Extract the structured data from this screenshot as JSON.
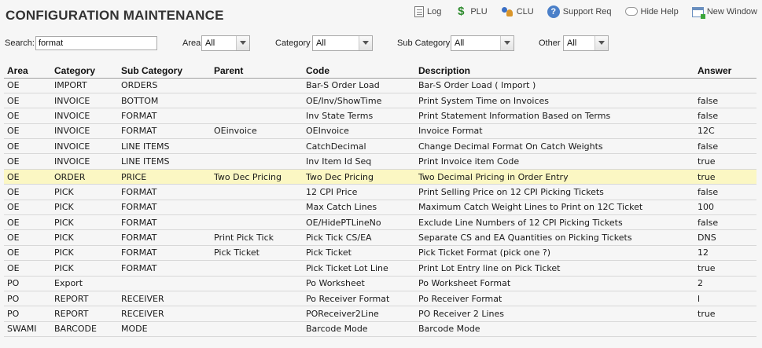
{
  "page": {
    "title": "CONFIGURATION MAINTENANCE"
  },
  "toolbar": {
    "items": [
      {
        "label": "Log",
        "icon": "log-icon"
      },
      {
        "label": "PLU",
        "icon": "dollar-icon"
      },
      {
        "label": "CLU",
        "icon": "users-icon"
      },
      {
        "label": "Support Req",
        "icon": "support-icon"
      },
      {
        "label": "Hide Help",
        "icon": "speech-bubble-icon"
      },
      {
        "label": "New Window",
        "icon": "new-window-icon"
      }
    ]
  },
  "filters": {
    "search_label": "Search:",
    "search_value": "format",
    "area_label": "Area",
    "area_value": "All",
    "category_label": "Category",
    "category_value": "All",
    "subcategory_label": "Sub Category",
    "subcategory_value": "All",
    "other_label": "Other",
    "other_value": "All"
  },
  "table": {
    "columns": [
      "Area",
      "Category",
      "Sub Category",
      "Parent",
      "Code",
      "Description",
      "Answer"
    ],
    "highlight_color": "#fbf7c3",
    "highlighted_row": 6,
    "rows": [
      [
        "OE",
        "IMPORT",
        "ORDERS",
        "",
        "Bar-S Order Load",
        "Bar-S Order Load ( Import )",
        ""
      ],
      [
        "OE",
        "INVOICE",
        "BOTTOM",
        "",
        "OE/Inv/ShowTime",
        "Print System Time on Invoices",
        "false"
      ],
      [
        "OE",
        "INVOICE",
        "FORMAT",
        "",
        "Inv State Terms",
        "Print Statement Information Based on Terms",
        "false"
      ],
      [
        "OE",
        "INVOICE",
        "FORMAT",
        "OEinvoice",
        "OEInvoice",
        "Invoice Format",
        "12C"
      ],
      [
        "OE",
        "INVOICE",
        "LINE ITEMS",
        "",
        "CatchDecimal",
        "Change Decimal Format On Catch Weights",
        "false"
      ],
      [
        "OE",
        "INVOICE",
        "LINE ITEMS",
        "",
        "Inv Item Id Seq",
        "Print Invoice item Code",
        "true"
      ],
      [
        "OE",
        "ORDER",
        "PRICE",
        "Two Dec Pricing",
        "Two Dec Pricing",
        "Two Decimal Pricing in Order Entry",
        "true"
      ],
      [
        "OE",
        "PICK",
        "FORMAT",
        "",
        "12 CPI Price",
        "Print Selling Price on 12 CPI Picking Tickets",
        "false"
      ],
      [
        "OE",
        "PICK",
        "FORMAT",
        "",
        "Max Catch Lines",
        "Maximum Catch Weight Lines to Print on 12C Ticket",
        "100"
      ],
      [
        "OE",
        "PICK",
        "FORMAT",
        "",
        "OE/HidePTLineNo",
        "Exclude Line Numbers of 12 CPI Picking Tickets",
        "false"
      ],
      [
        "OE",
        "PICK",
        "FORMAT",
        "Print Pick Tick",
        "Pick Tick CS/EA",
        "Separate CS and EA Quantities on Picking Tickets",
        "DNS"
      ],
      [
        "OE",
        "PICK",
        "FORMAT",
        "Pick Ticket",
        "Pick Ticket",
        "Pick Ticket Format (pick one ?)",
        "12"
      ],
      [
        "OE",
        "PICK",
        "FORMAT",
        "",
        "Pick Ticket Lot Line",
        "Print Lot Entry line on Pick Ticket",
        "true"
      ],
      [
        "PO",
        "Export",
        "",
        "",
        "Po Worksheet",
        "Po Worksheet Format",
        "2"
      ],
      [
        "PO",
        "REPORT",
        "RECEIVER",
        "",
        "Po Receiver Format",
        "Po Receiver Format",
        "l"
      ],
      [
        "PO",
        "REPORT",
        "RECEIVER",
        "",
        "POReceiver2Line",
        "PO Receiver 2 Lines",
        "true"
      ],
      [
        "SWAMI",
        "BARCODE",
        "MODE",
        "",
        "Barcode Mode",
        "Barcode Mode",
        ""
      ]
    ]
  }
}
